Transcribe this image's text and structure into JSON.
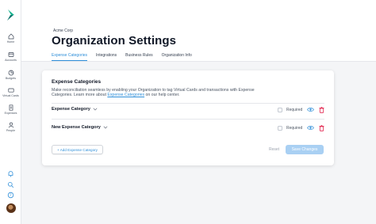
{
  "sidebar": {
    "items": [
      {
        "label": "Home",
        "icon": "home-icon"
      },
      {
        "label": "Accounts",
        "icon": "accounts-icon"
      },
      {
        "label": "Budgets",
        "icon": "budgets-icon"
      },
      {
        "label": "Virtual Cards",
        "icon": "virtual-cards-icon"
      },
      {
        "label": "Expenses",
        "icon": "expenses-icon"
      },
      {
        "label": "People",
        "icon": "people-icon"
      }
    ],
    "bottom_icons": [
      "bell-icon",
      "search-icon",
      "help-icon"
    ]
  },
  "header": {
    "breadcrumb": "Acme Corp",
    "title": "Organization Settings",
    "tabs": [
      {
        "label": "Expense Categories",
        "active": true
      },
      {
        "label": "Integrations",
        "active": false
      },
      {
        "label": "Business Rules",
        "active": false
      },
      {
        "label": "Organization Info",
        "active": false
      }
    ]
  },
  "card": {
    "title": "Expense Categories",
    "description_prefix": "Make reconciliation seamless by enabling your Organization to tag Virtual Cards and transactions with Expense Categories. Learn more about ",
    "description_link": "Expense Categories",
    "description_suffix": " on our help center.",
    "categories": [
      {
        "name": "Expense Category",
        "required_label": "Required",
        "required": false
      },
      {
        "name": "New Expense Category",
        "required_label": "Required",
        "required": false
      }
    ],
    "add_button": "+ Add Expense Category",
    "reset_button": "Reset",
    "save_button": "Save Changes"
  },
  "colors": {
    "accent": "#2f8fd9",
    "brand": "#19b38f",
    "danger": "#e11d48",
    "save_disabled": "#a9d0f3"
  }
}
